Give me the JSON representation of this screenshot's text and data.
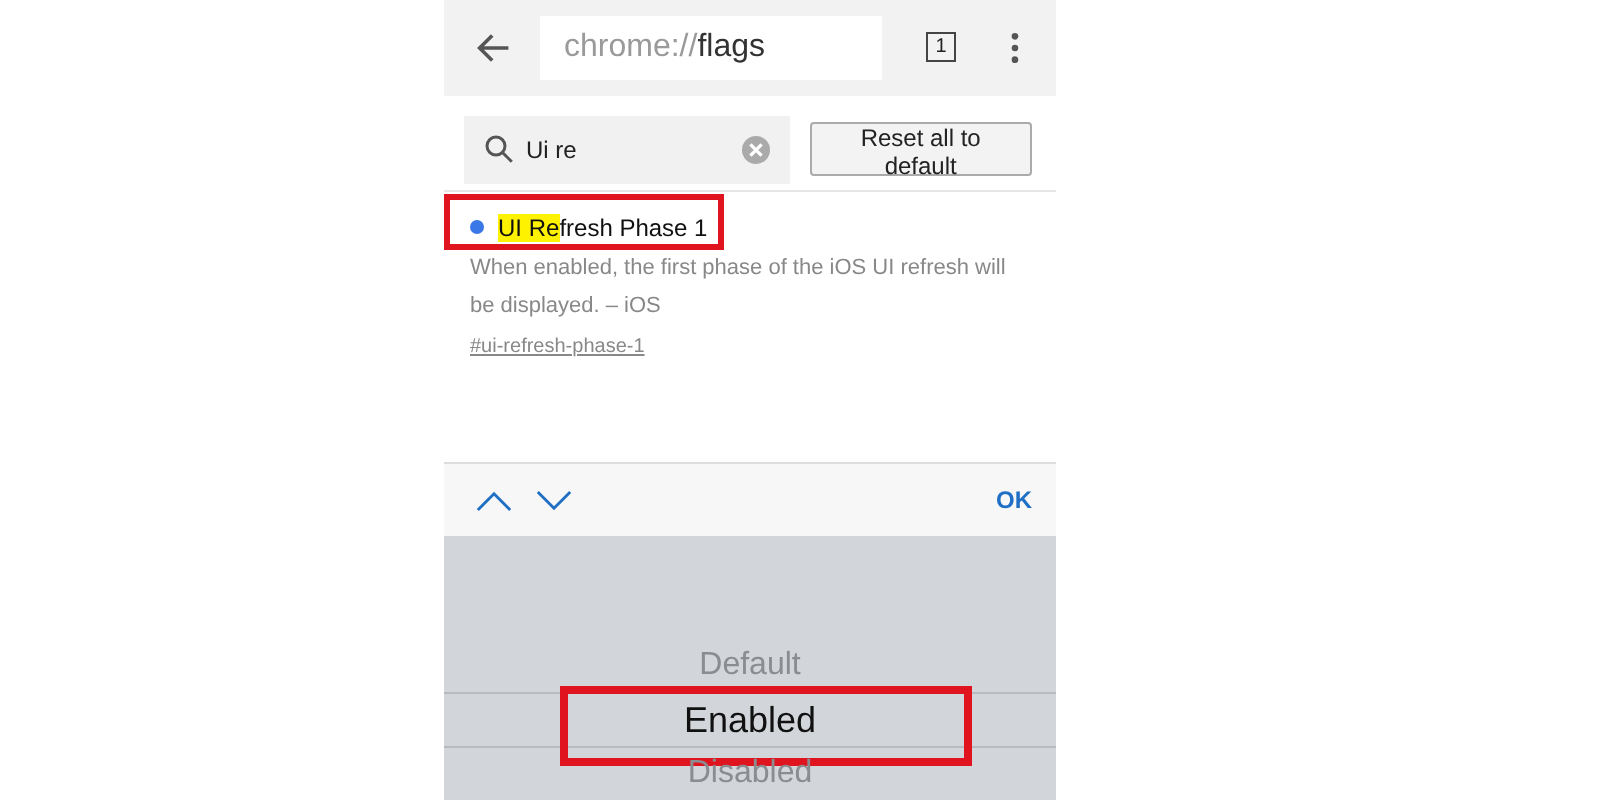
{
  "toolbar": {
    "url_scheme": "chrome://",
    "url_path": "flags",
    "tab_count": "1"
  },
  "search": {
    "value": "Ui re"
  },
  "reset_button": "Reset all to default",
  "flag": {
    "annotated": true,
    "title": [
      {
        "text": "UI Re",
        "highlighted": true
      },
      {
        "text": "fresh Phase 1",
        "highlighted": false
      }
    ],
    "description": "When enabled, the first phase of the iOS UI refresh will be displayed. – iOS",
    "link": "#ui-refresh-phase-1"
  },
  "picker_bar": {
    "done": "OK"
  },
  "options": [
    {
      "label": "Default",
      "selected": false,
      "annotated": false
    },
    {
      "label": "Enabled",
      "selected": true,
      "annotated": true
    },
    {
      "label": "Disabled",
      "selected": false,
      "annotated": false
    }
  ]
}
